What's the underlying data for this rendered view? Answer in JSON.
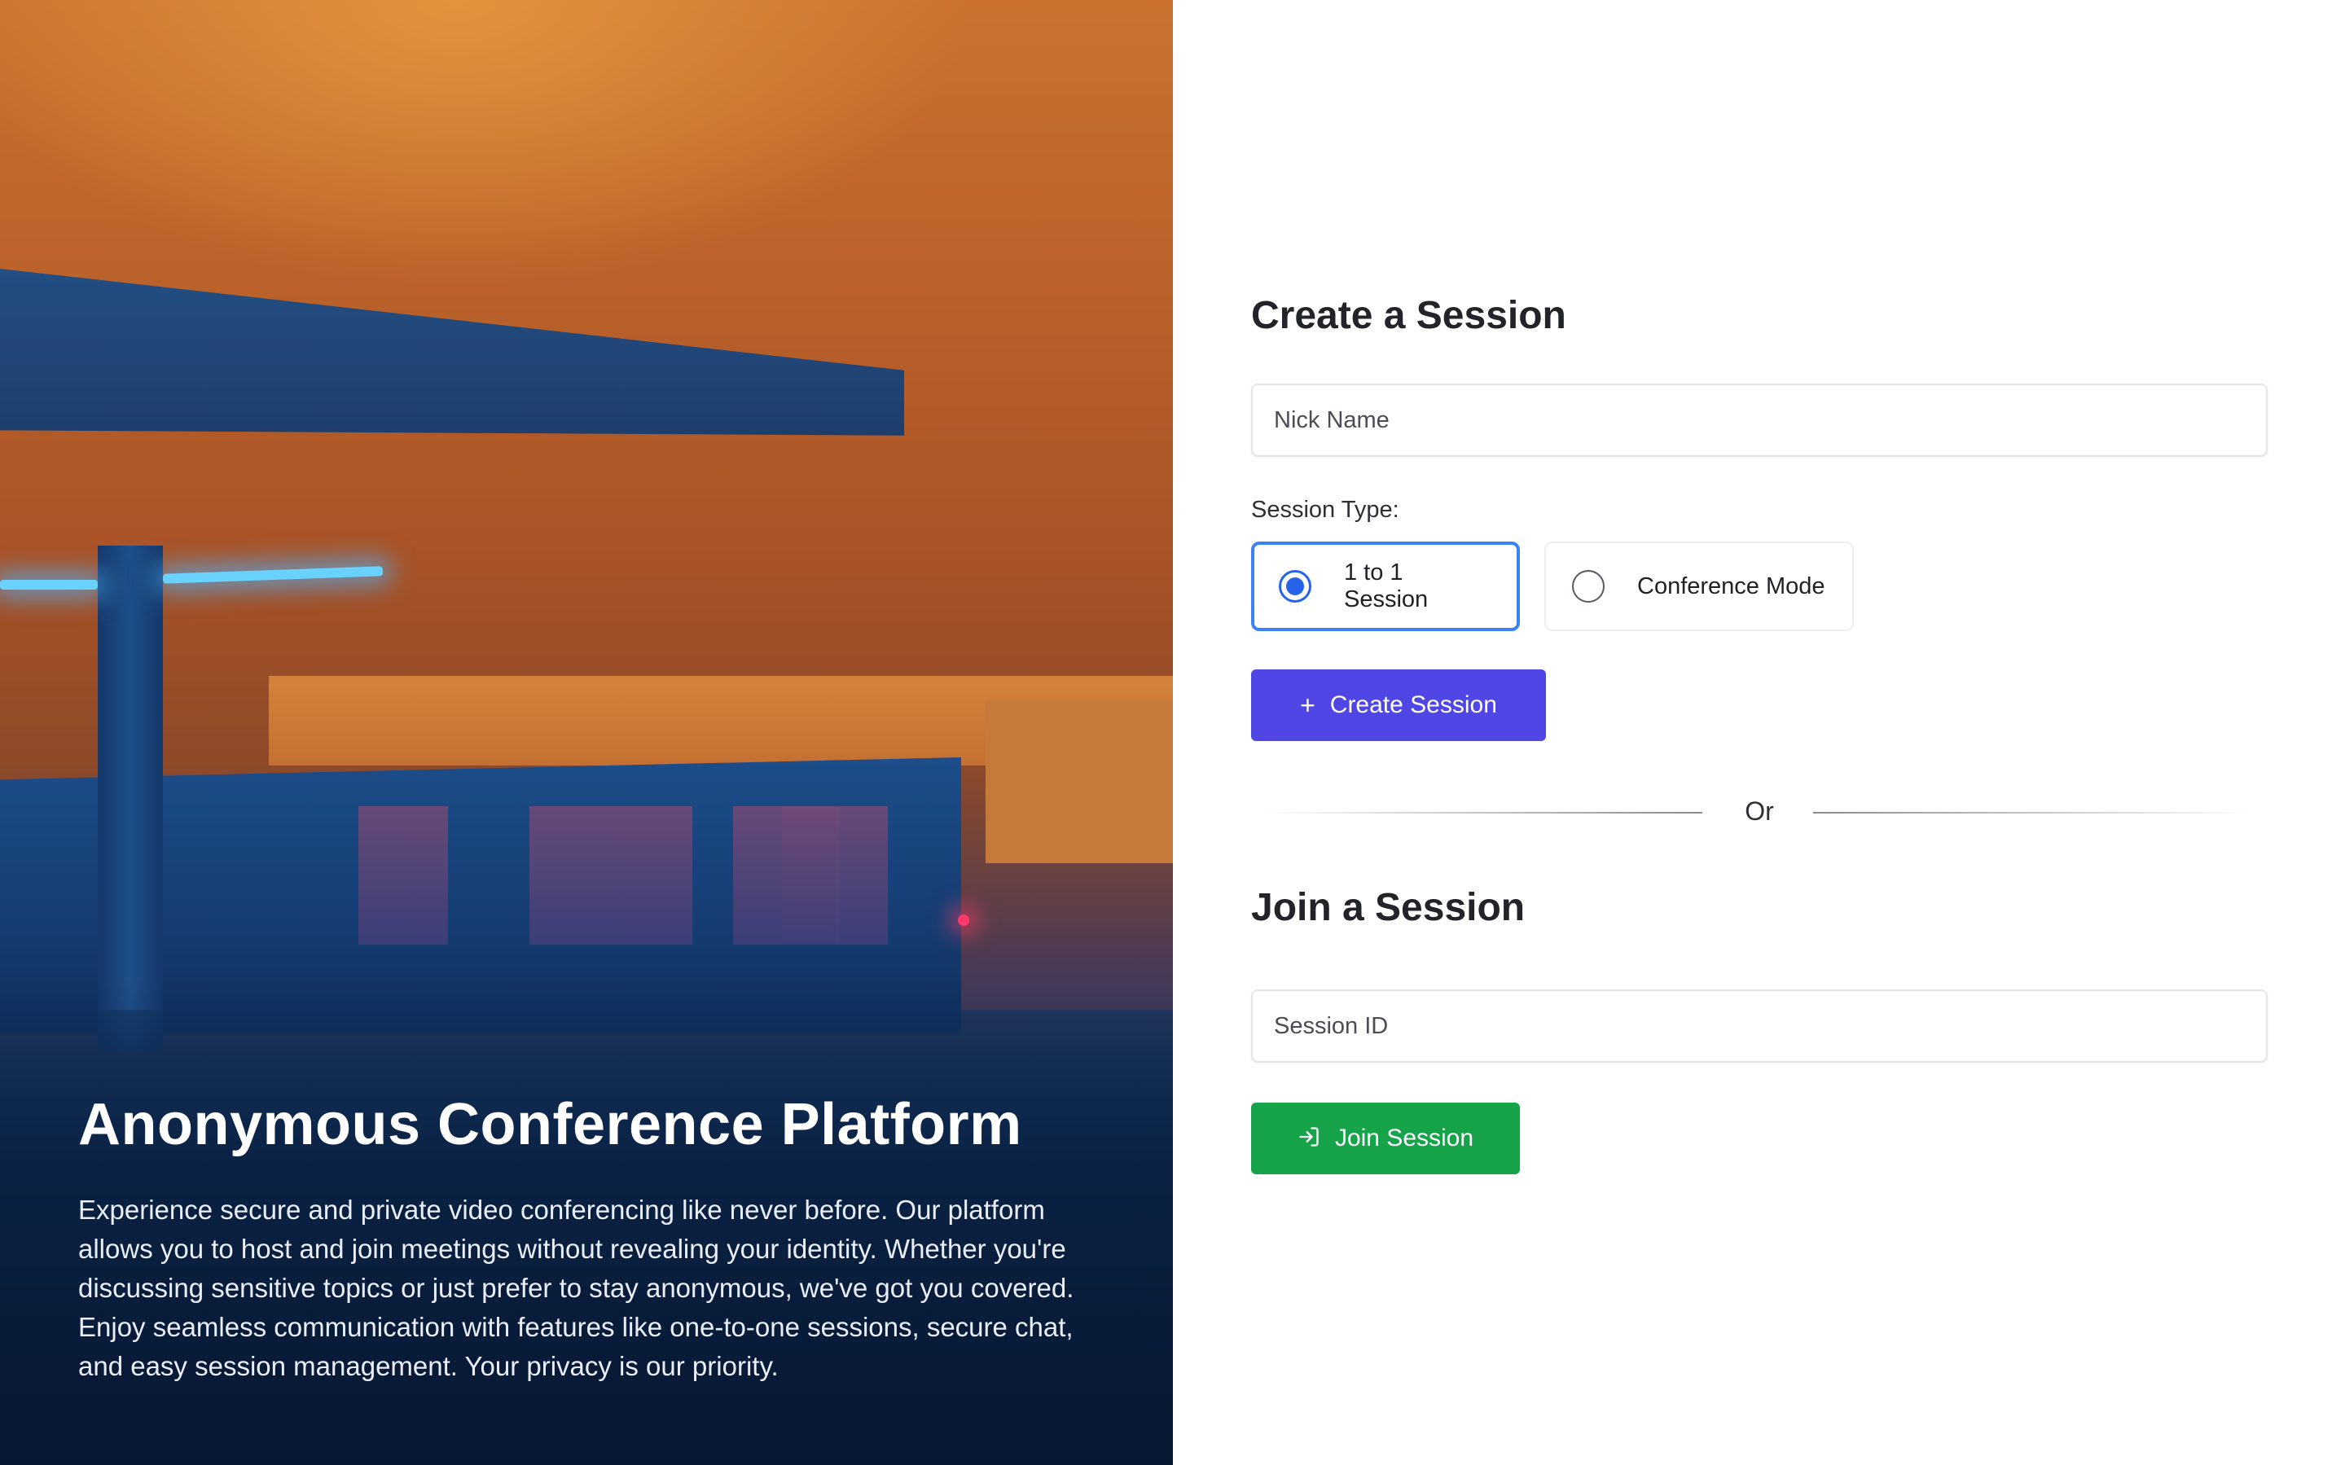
{
  "hero": {
    "title": "Anonymous Conference Platform",
    "description": "Experience secure and private video conferencing like never before. Our platform allows you to host and join meetings without revealing your identity. Whether you're discussing sensitive topics or just prefer to stay anonymous, we've got you covered. Enjoy seamless communication with features like one-to-one sessions, secure chat, and easy session management. Your privacy is our priority."
  },
  "create": {
    "title": "Create a Session",
    "nickname_placeholder": "Nick Name",
    "nickname_value": "",
    "session_type_label": "Session Type:",
    "options": [
      {
        "label": "1 to 1 Session",
        "selected": true
      },
      {
        "label": "Conference Mode",
        "selected": false
      }
    ],
    "button_label": "Create Session",
    "button_icon": "plus-icon",
    "button_color": "#4f46e5"
  },
  "divider": {
    "text": "Or"
  },
  "join": {
    "title": "Join a Session",
    "session_id_placeholder": "Session ID",
    "session_id_value": "",
    "button_label": "Join Session",
    "button_icon": "login-icon",
    "button_color": "#16a34a"
  },
  "colors": {
    "selected_border": "#3b82f6",
    "radio_accent": "#2563eb"
  }
}
